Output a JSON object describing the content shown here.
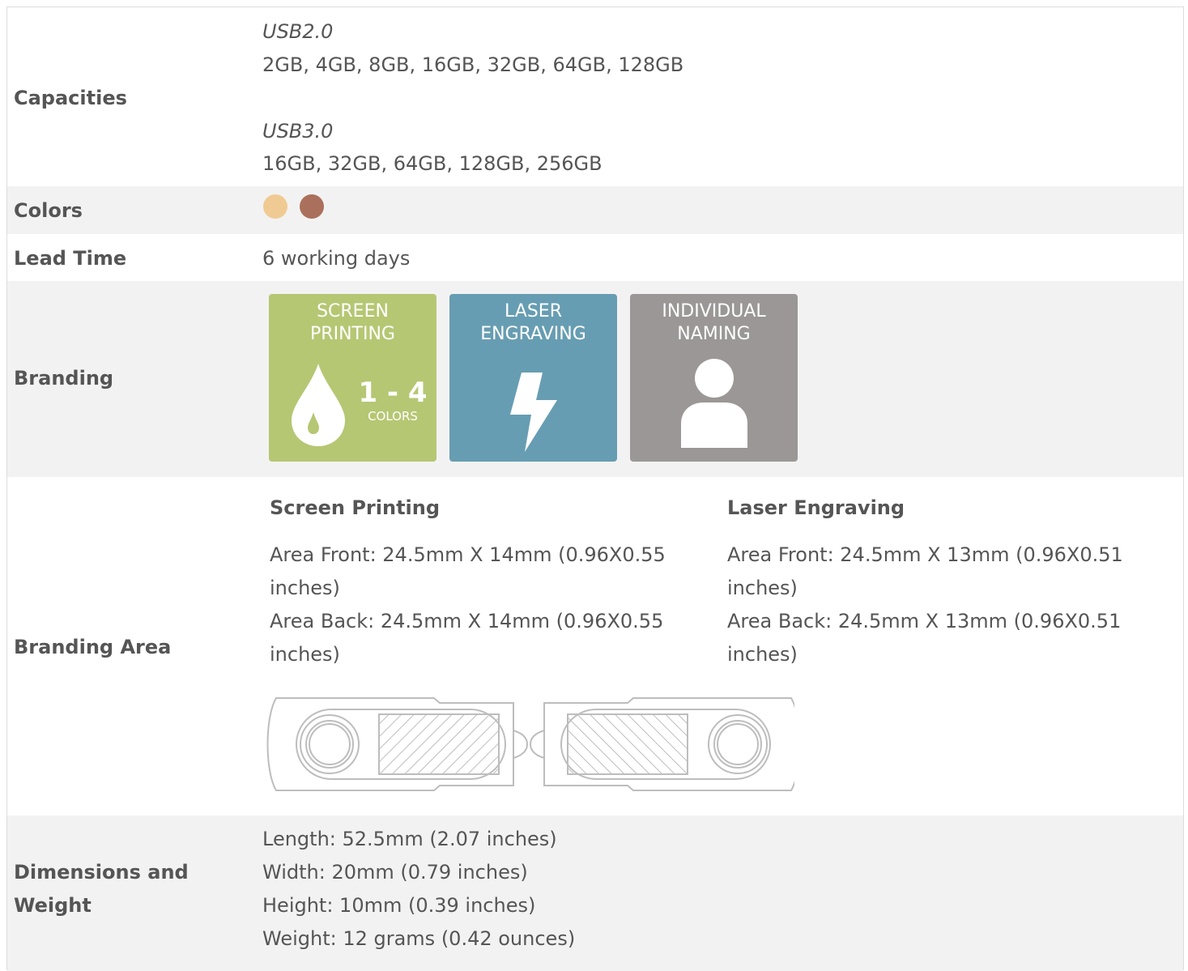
{
  "colors": {
    "shade": "#f3f2f2",
    "screen_printing": "#b5c773",
    "laser_engraving": "#679db2",
    "individual_naming": "#9a9796",
    "swatches": [
      "#efcb93",
      "#aa705c"
    ]
  },
  "capacities": {
    "label": "Capacities",
    "usb2_title": "USB2.0",
    "usb2_list": "2GB, 4GB, 8GB, 16GB, 32GB, 64GB, 128GB",
    "usb3_title": "USB3.0",
    "usb3_list": "16GB, 32GB, 64GB, 128GB, 256GB"
  },
  "colors_row": {
    "label": "Colors"
  },
  "lead_time": {
    "label": "Lead Time",
    "value": "6 working days"
  },
  "branding": {
    "label": "Branding",
    "tiles": [
      {
        "line1": "SCREEN",
        "line2": "PRINTING",
        "range": "1 - 4",
        "sub": "COLORS",
        "icon": "drop-icon"
      },
      {
        "line1": "LASER",
        "line2": "ENGRAVING",
        "icon": "lightning-icon"
      },
      {
        "line1": "INDIVIDUAL",
        "line2": "NAMING",
        "icon": "person-icon"
      }
    ]
  },
  "branding_area": {
    "label": "Branding Area",
    "screen_printing": {
      "heading": "Screen Printing",
      "front_a": "Area Front: 24.5mm X 14mm (0.96X0.55",
      "front_b": "inches)",
      "back_a": "Area Back: 24.5mm X 14mm (0.96X0.55",
      "back_b": "inches)"
    },
    "laser_engraving": {
      "heading": "Laser Engraving",
      "front_a": "Area Front: 24.5mm X 13mm (0.96X0.51",
      "front_b": "inches)",
      "back_a": "Area Back: 24.5mm X 13mm (0.96X0.51",
      "back_b": "inches)"
    }
  },
  "dimensions": {
    "label_line1": "Dimensions and",
    "label_line2": "Weight",
    "length": "Length: 52.5mm (2.07 inches)",
    "width": "Width: 20mm (0.79 inches)",
    "height": "Height: 10mm (0.39 inches)",
    "weight": "Weight: 12 grams (0.42 ounces)"
  }
}
